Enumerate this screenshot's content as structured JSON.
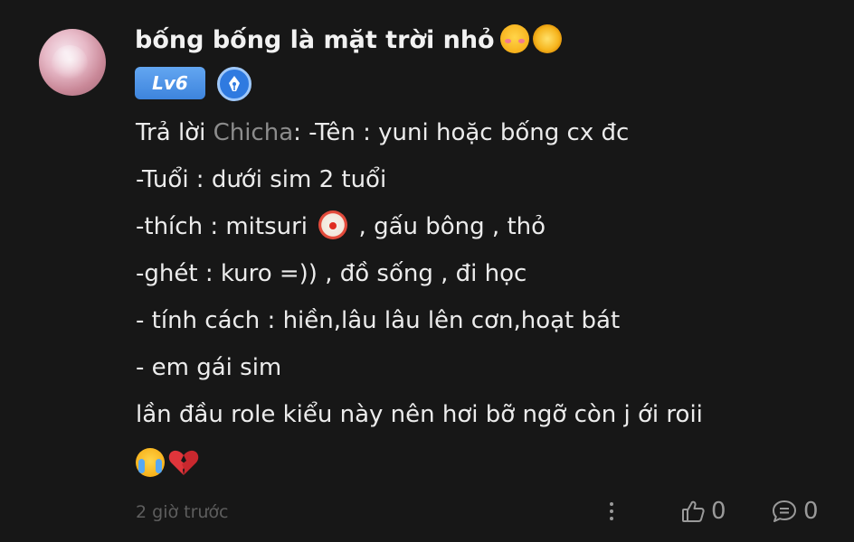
{
  "comment": {
    "username": "bống bống là mặt trời nhỏ",
    "level": "Lv6",
    "reply_prefix": "Trả lời ",
    "reply_to": "Chicha",
    "line1_rest": ": -Tên : yuni hoặc bống cx đc",
    "line2": "-Tuổi : dưới sim 2 tuổi",
    "line3_a": "-thích : mitsuri ",
    "line3_b": " , gấu bông , thỏ",
    "line4": "-ghét : kuro =)) , đồ sống , đi học",
    "line5": "- tính cách : hiền,lâu lâu lên cơn,hoạt bát",
    "line6": "- em gái sim",
    "line7": "lần đầu role kiểu này nên hơi bỡ ngỡ còn j ới roii",
    "time": "2 giờ trước",
    "like_count": "0",
    "reply_count": "0"
  },
  "icons": {
    "avatar": "avatar-image",
    "emoji_after_name": [
      "smiling-face-with-hearts-icon",
      "sun-with-face-icon"
    ],
    "badge": "pen-nib-icon",
    "emoji_line3": "clown-face-icon",
    "emoji_line8": [
      "loudly-crying-face-icon",
      "broken-heart-icon"
    ],
    "actions": [
      "more-icon",
      "thumbs-up-icon",
      "comment-icon"
    ]
  },
  "colors": {
    "background": "#171717",
    "text": "#ececec",
    "mention": "#8c8c8c",
    "muted": "#5e5e5e",
    "level_badge": "#4a8fe6",
    "action_icon": "#9a9a9a"
  }
}
